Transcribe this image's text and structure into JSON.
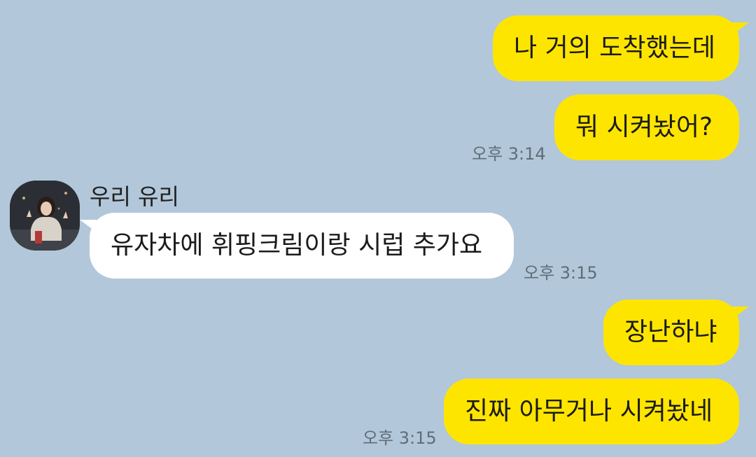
{
  "messages": [
    {
      "from": "me",
      "text": "나 거의 도착했는데"
    },
    {
      "from": "me",
      "text": "뭐 시켜놨어?"
    },
    {
      "from": "other",
      "text": "유자차에 휘핑크림이랑 시럽 추가요"
    },
    {
      "from": "me",
      "text": "장난하냐"
    },
    {
      "from": "me",
      "text": "진짜 아무거나 시켜놨네"
    }
  ],
  "timestamps": {
    "group1": "오후 3:14",
    "group2": "오후 3:15",
    "group3": "오후 3:15"
  },
  "sender": {
    "name": "우리 유리",
    "avatar_icon": "profile-photo"
  },
  "colors": {
    "background": "#b2c7da",
    "my_bubble": "#fee500",
    "their_bubble": "#ffffff",
    "time_text": "#5f6d79"
  }
}
